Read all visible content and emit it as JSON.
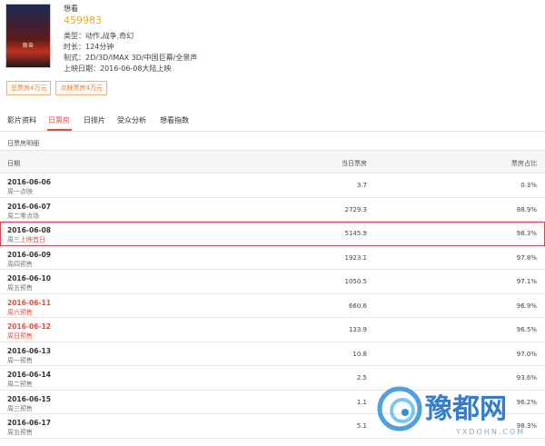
{
  "movie": {
    "poster_text": "魔兽",
    "want_label": "想看",
    "want_count": "459983",
    "details": [
      "类型：动作,战争,奇幻",
      "时长：124分钟",
      "制式：2D/3D/IMAX 3D/中国巨幕/全景声",
      "上映日期：2016-06-08大陆上映"
    ],
    "pill_total": "总票房4万元",
    "pill_point": "点映票房4万元"
  },
  "tabs": [
    "影片资料",
    "日票房",
    "日排片",
    "受众分析",
    "想看指数"
  ],
  "active_tab": "日票房",
  "section_title": "日票房明细",
  "table": {
    "headers": {
      "date": "日期",
      "box": "当日票房",
      "pct": "票房占比"
    },
    "rows": [
      {
        "date": "2016-06-06",
        "note": "周一点映",
        "note_hl": "",
        "box": "3.7",
        "pct": "0.3%"
      },
      {
        "date": "2016-06-07",
        "note": "周二零点场",
        "note_hl": "",
        "box": "2729.3",
        "pct": "88.9%"
      },
      {
        "date": "2016-06-08",
        "note": "周三",
        "note_hl": "上映首日",
        "box": "5145.9",
        "pct": "98.3%"
      },
      {
        "date": "2016-06-09",
        "note": "周四预售",
        "note_hl": "",
        "box": "1923.1",
        "pct": "97.8%"
      },
      {
        "date": "2016-06-10",
        "note": "周五预售",
        "note_hl": "",
        "box": "1050.5",
        "pct": "97.1%"
      },
      {
        "date": "2016-06-11",
        "note": "周六预售",
        "note_hl": "",
        "box": "660.6",
        "pct": "96.9%"
      },
      {
        "date": "2016-06-12",
        "note": "周日预售",
        "note_hl": "",
        "box": "133.9",
        "pct": "96.5%"
      },
      {
        "date": "2016-06-13",
        "note": "周一预售",
        "note_hl": "",
        "box": "10.8",
        "pct": "97.0%"
      },
      {
        "date": "2016-06-14",
        "note": "周二预售",
        "note_hl": "",
        "box": "2.5",
        "pct": "93.6%"
      },
      {
        "date": "2016-06-15",
        "note": "周三预售",
        "note_hl": "",
        "box": "1.1",
        "pct": "96.2%"
      },
      {
        "date": "2016-06-17",
        "note": "周五预售",
        "note_hl": "",
        "box": "5.1",
        "pct": "98.3%"
      }
    ]
  },
  "watermark": {
    "text": "豫都网",
    "url": "YXDOHN.COM"
  },
  "colors": {
    "accent": "#e84b3c",
    "count": "#f5a623",
    "box_outline": "#d8404b"
  }
}
